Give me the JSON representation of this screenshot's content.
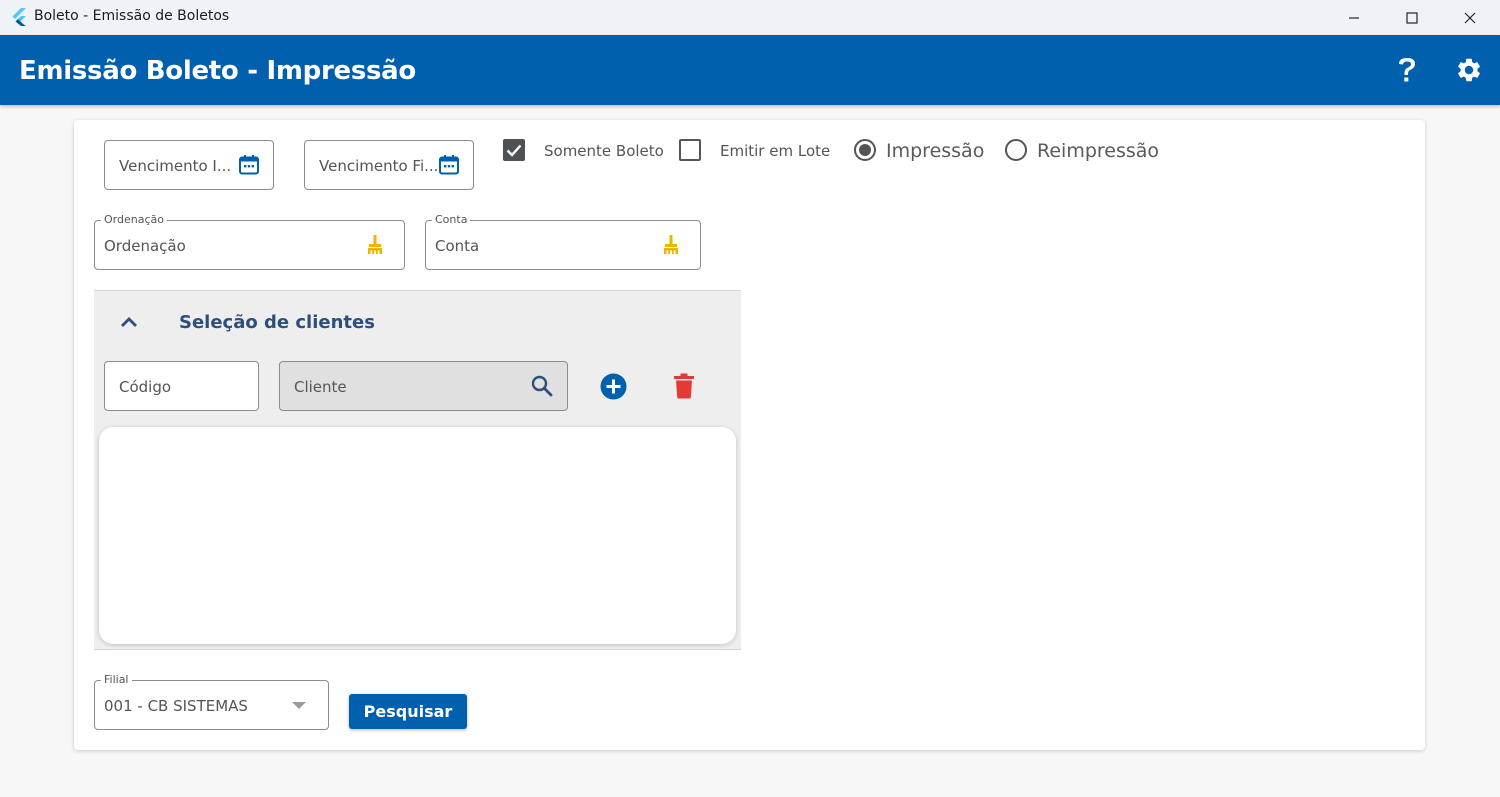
{
  "window": {
    "title": "Boleto - Emissão de Boletos"
  },
  "header": {
    "title": "Emissão Boleto - Impressão",
    "help_icon": "help-icon",
    "settings_icon": "gear-icon"
  },
  "filters": {
    "vencimento_inicial": {
      "placeholder": "Vencimento I..."
    },
    "vencimento_final": {
      "placeholder": "Vencimento Fi..."
    },
    "somente_boleto": {
      "label": "Somente Boleto",
      "checked": true
    },
    "emitir_lote": {
      "label": "Emitir em Lote",
      "checked": false
    },
    "mode_options": [
      {
        "label": "Impressão",
        "selected": true
      },
      {
        "label": "Reimpressão",
        "selected": false
      }
    ],
    "ordenacao": {
      "label": "Ordenação",
      "value": "Ordenação"
    },
    "conta": {
      "label": "Conta",
      "value": "Conta"
    }
  },
  "client_selection": {
    "title": "Seleção de clientes",
    "codigo_placeholder": "Código",
    "cliente_placeholder": "Cliente"
  },
  "filial": {
    "label": "Filial",
    "value": "001 - CB SISTEMAS"
  },
  "actions": {
    "search_label": "Pesquisar"
  },
  "colors": {
    "primary": "#0060ad",
    "delete": "#e53935",
    "clear_icon": "#f0b400"
  }
}
